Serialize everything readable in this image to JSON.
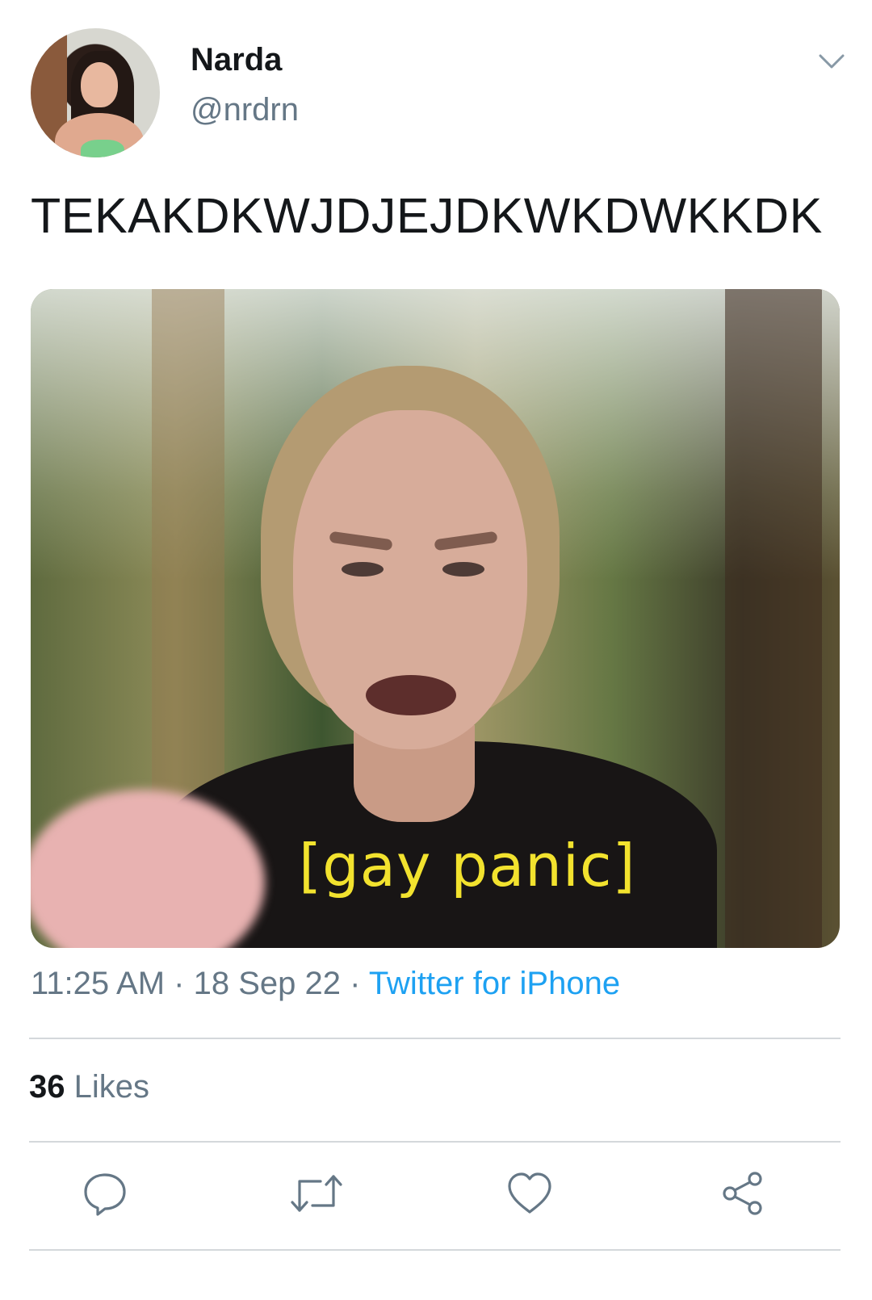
{
  "author": {
    "name": "Narda",
    "handle": "@nrdrn"
  },
  "tweet": {
    "text": "TEKAKDKWJDJEJDKWKDWKKDK",
    "image_caption": "[gay panic]"
  },
  "meta": {
    "time": "11:25 AM",
    "separator1": " · ",
    "date": "18 Sep 22",
    "separator2": " · ",
    "source": "Twitter for iPhone"
  },
  "stats": {
    "likes_count": "36",
    "likes_label": " Likes"
  },
  "icons": {
    "menu": "chevron-down-icon",
    "reply": "reply-icon",
    "retweet": "retweet-icon",
    "like": "heart-icon",
    "share": "share-icon"
  },
  "colors": {
    "text": "#14171a",
    "muted": "#657786",
    "link": "#1da1f2",
    "divider": "#d4d8db",
    "caption": "#f2e22e"
  }
}
